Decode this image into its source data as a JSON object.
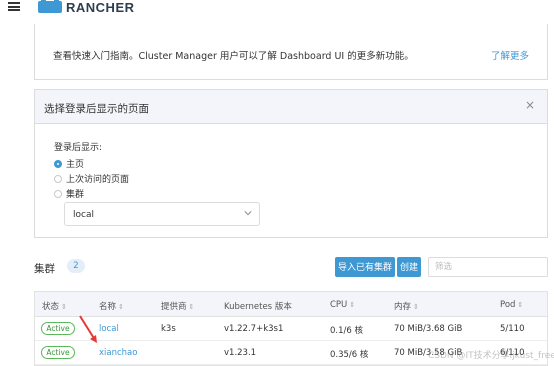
{
  "header": {
    "logo_text": "RANCHER"
  },
  "banner": {
    "text": "查看快速入门指南。Cluster Manager 用户可以了解 Dashboard UI 的更多新功能。",
    "link": "了解更多"
  },
  "login_panel": {
    "title": "选择登录后显示的页面",
    "close": "×",
    "show_label": "登录后显示:",
    "options": [
      {
        "label": "主页",
        "checked": true
      },
      {
        "label": "上次访问的页面",
        "checked": false
      },
      {
        "label": "集群",
        "checked": false
      }
    ],
    "cluster_select": {
      "value": "local"
    }
  },
  "clusters": {
    "title": "集群",
    "count": "2",
    "import_button": "导入已有集群",
    "create_button": "创建",
    "filter_placeholder": "筛选",
    "columns": [
      "状态",
      "名称",
      "提供商",
      "Kubernetes 版本",
      "CPU",
      "内存",
      "Pod"
    ],
    "rows": [
      {
        "status": "Active",
        "name": "local",
        "provider": "k3s",
        "version": "v1.22.7+k3s1",
        "cpu": "0.1/6 核",
        "memory": "70 MiB/3.68 GiB",
        "pods": "5/110"
      },
      {
        "status": "Active",
        "name": "xianchao",
        "provider": "",
        "version": "v1.23.1",
        "cpu": "0.35/6 核",
        "memory": "70 MiB/3.58 GiB",
        "pods": "6/110"
      }
    ]
  },
  "watermark": "CSDN @IT技术分享ljkust_free",
  "colors": {
    "accent": "#3d98d3",
    "active": "#5bb75b",
    "arrow": "#e53935"
  }
}
